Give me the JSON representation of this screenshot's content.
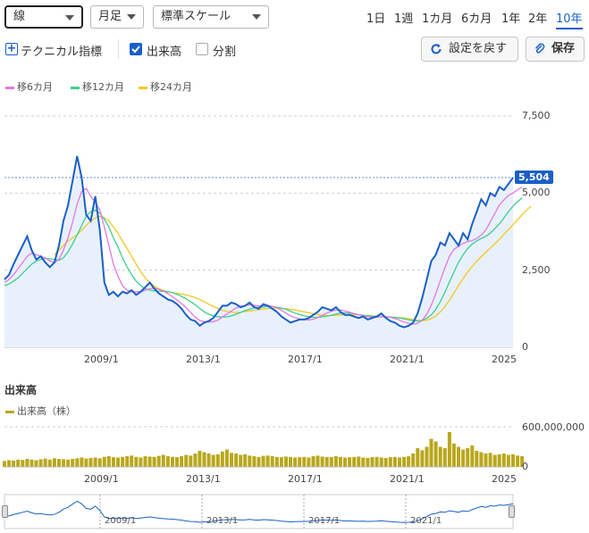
{
  "toolbar": {
    "chart_type": "線",
    "interval": "月足",
    "scale": "標準スケール",
    "periods": [
      "1日",
      "1週",
      "1カ月",
      "6カ月",
      "1年",
      "2年",
      "10年"
    ],
    "selected_period": "10年"
  },
  "options": {
    "technical_label": "テクニカル指標",
    "volume_label": "出来高",
    "volume_checked": true,
    "split_label": "分割",
    "split_checked": false,
    "reset_label": "設定を戻す",
    "save_label": "保存"
  },
  "legend": {
    "ma6": "移6カ月",
    "ma12": "移12カ月",
    "ma24": "移24カ月"
  },
  "colors": {
    "price": "#1a5fc7",
    "ma6": "#e377e3",
    "ma12": "#3ccf8e",
    "ma24": "#f2c824",
    "volume": "#b9a71c",
    "accent": "#1a5fc7"
  },
  "volume_section": {
    "title": "出来高",
    "legend_label": "出来高（株）"
  },
  "chart_data": {
    "type": "line",
    "x_ticks": [
      "2009/1",
      "2013/1",
      "2017/1",
      "2021/1",
      "2025"
    ],
    "price_axis": {
      "ticks": [
        "7,500",
        "5,000",
        "2,500",
        "0"
      ],
      "ylim": [
        0,
        7500
      ]
    },
    "last_price": "5,504",
    "price": [
      2200,
      2350,
      2700,
      3000,
      3300,
      3600,
      3150,
      2850,
      2950,
      2750,
      2600,
      2750,
      3300,
      4100,
      4600,
      5400,
      6200,
      5500,
      4300,
      4100,
      4900,
      3800,
      2100,
      1700,
      1800,
      1650,
      1800,
      1750,
      1850,
      1700,
      1800,
      1950,
      2100,
      1900,
      1750,
      1650,
      1550,
      1500,
      1400,
      1250,
      1050,
      900,
      850,
      700,
      800,
      850,
      950,
      1150,
      1350,
      1350,
      1450,
      1400,
      1300,
      1350,
      1450,
      1300,
      1250,
      1400,
      1350,
      1250,
      1150,
      1000,
      900,
      800,
      850,
      900,
      900,
      950,
      1050,
      1150,
      1300,
      1250,
      1200,
      1300,
      1150,
      1050,
      1050,
      1000,
      950,
      1000,
      900,
      950,
      1000,
      1100,
      950,
      850,
      800,
      700,
      650,
      700,
      800,
      1100,
      1600,
      2200,
      2800,
      3000,
      3400,
      3300,
      3700,
      3500,
      3300,
      3700,
      3500,
      4000,
      4400,
      4800,
      4600,
      5000,
      4900,
      5200,
      5100,
      5300,
      5504
    ],
    "ma6": [
      2100,
      2200,
      2350,
      2550,
      2750,
      2950,
      3050,
      3000,
      2950,
      2900,
      2800,
      2750,
      2850,
      3150,
      3550,
      4050,
      4650,
      5050,
      5150,
      4900,
      4700,
      4450,
      3900,
      3300,
      2700,
      2300,
      2000,
      1850,
      1800,
      1800,
      1800,
      1850,
      1900,
      1920,
      1880,
      1820,
      1740,
      1640,
      1530,
      1420,
      1290,
      1130,
      980,
      870,
      830,
      820,
      830,
      880,
      980,
      1080,
      1180,
      1280,
      1330,
      1360,
      1380,
      1360,
      1340,
      1350,
      1350,
      1330,
      1280,
      1200,
      1110,
      1020,
      960,
      920,
      890,
      890,
      910,
      960,
      1040,
      1110,
      1170,
      1210,
      1210,
      1180,
      1140,
      1090,
      1050,
      1020,
      990,
      980,
      980,
      990,
      990,
      970,
      930,
      880,
      820,
      780,
      750,
      780,
      880,
      1070,
      1370,
      1740,
      2170,
      2580,
      2950,
      3180,
      3280,
      3370,
      3430,
      3460,
      3530,
      3640,
      3800,
      4070,
      4340,
      4620,
      4780,
      4930,
      5000,
      5110,
      5200
    ],
    "ma12": [
      2000,
      2050,
      2150,
      2250,
      2400,
      2550,
      2700,
      2800,
      2850,
      2880,
      2870,
      2850,
      2820,
      2900,
      3100,
      3350,
      3650,
      3950,
      4250,
      4400,
      4450,
      4350,
      4150,
      3900,
      3550,
      3250,
      2900,
      2600,
      2350,
      2150,
      2000,
      1900,
      1850,
      1830,
      1820,
      1810,
      1800,
      1770,
      1720,
      1650,
      1570,
      1480,
      1380,
      1260,
      1150,
      1070,
      1020,
      990,
      980,
      990,
      1020,
      1070,
      1130,
      1190,
      1240,
      1280,
      1300,
      1310,
      1320,
      1320,
      1300,
      1270,
      1230,
      1170,
      1110,
      1060,
      1020,
      990,
      970,
      970,
      990,
      1010,
      1040,
      1080,
      1110,
      1120,
      1110,
      1090,
      1060,
      1040,
      1020,
      1010,
      1000,
      1000,
      990,
      980,
      970,
      950,
      920,
      890,
      860,
      850,
      880,
      940,
      1050,
      1230,
      1480,
      1790,
      2120,
      2450,
      2750,
      3000,
      3200,
      3350,
      3450,
      3530,
      3600,
      3700,
      3850,
      4000,
      4200,
      4400,
      4580,
      4720,
      4850
    ],
    "ma24": [
      null,
      null,
      null,
      null,
      null,
      null,
      null,
      null,
      null,
      null,
      null,
      3000,
      3150,
      3300,
      3450,
      3550,
      3650,
      3800,
      3950,
      4100,
      4200,
      4250,
      4200,
      4100,
      3900,
      3700,
      3450,
      3200,
      2950,
      2700,
      2450,
      2250,
      2100,
      1980,
      1900,
      1850,
      1800,
      1770,
      1750,
      1730,
      1700,
      1660,
      1610,
      1550,
      1480,
      1400,
      1330,
      1260,
      1200,
      1160,
      1140,
      1130,
      1140,
      1160,
      1180,
      1200,
      1220,
      1240,
      1260,
      1270,
      1270,
      1260,
      1250,
      1230,
      1210,
      1180,
      1150,
      1120,
      1090,
      1060,
      1040,
      1030,
      1030,
      1040,
      1050,
      1060,
      1060,
      1060,
      1050,
      1040,
      1030,
      1020,
      1010,
      1000,
      990,
      980,
      970,
      960,
      950,
      930,
      900,
      870,
      860,
      880,
      930,
      1020,
      1150,
      1320,
      1530,
      1760,
      2000,
      2230,
      2440,
      2620,
      2790,
      2940,
      3080,
      3220,
      3360,
      3500,
      3660,
      3820,
      3980,
      4140,
      4300,
      4450,
      4580
    ],
    "volume_axis": {
      "ticks": [
        "600,000,000",
        "0"
      ],
      "ylim": [
        0,
        600000000
      ]
    },
    "volume": [
      90000000,
      100000000,
      95000000,
      110000000,
      105000000,
      120000000,
      110000000,
      100000000,
      115000000,
      125000000,
      110000000,
      130000000,
      120000000,
      115000000,
      110000000,
      120000000,
      130000000,
      140000000,
      125000000,
      135000000,
      140000000,
      130000000,
      150000000,
      160000000,
      145000000,
      140000000,
      150000000,
      160000000,
      170000000,
      150000000,
      140000000,
      160000000,
      155000000,
      150000000,
      165000000,
      180000000,
      160000000,
      150000000,
      145000000,
      160000000,
      180000000,
      170000000,
      200000000,
      240000000,
      220000000,
      200000000,
      180000000,
      190000000,
      230000000,
      260000000,
      210000000,
      200000000,
      180000000,
      190000000,
      170000000,
      160000000,
      150000000,
      165000000,
      170000000,
      160000000,
      150000000,
      145000000,
      155000000,
      150000000,
      140000000,
      145000000,
      150000000,
      140000000,
      160000000,
      170000000,
      155000000,
      150000000,
      145000000,
      160000000,
      150000000,
      140000000,
      145000000,
      150000000,
      155000000,
      140000000,
      135000000,
      145000000,
      150000000,
      140000000,
      135000000,
      145000000,
      150000000,
      140000000,
      150000000,
      160000000,
      200000000,
      280000000,
      250000000,
      300000000,
      420000000,
      380000000,
      300000000,
      280000000,
      520000000,
      350000000,
      300000000,
      260000000,
      280000000,
      320000000,
      240000000,
      220000000,
      200000000,
      210000000,
      180000000,
      190000000,
      200000000,
      180000000,
      190000000,
      170000000,
      160000000
    ]
  }
}
